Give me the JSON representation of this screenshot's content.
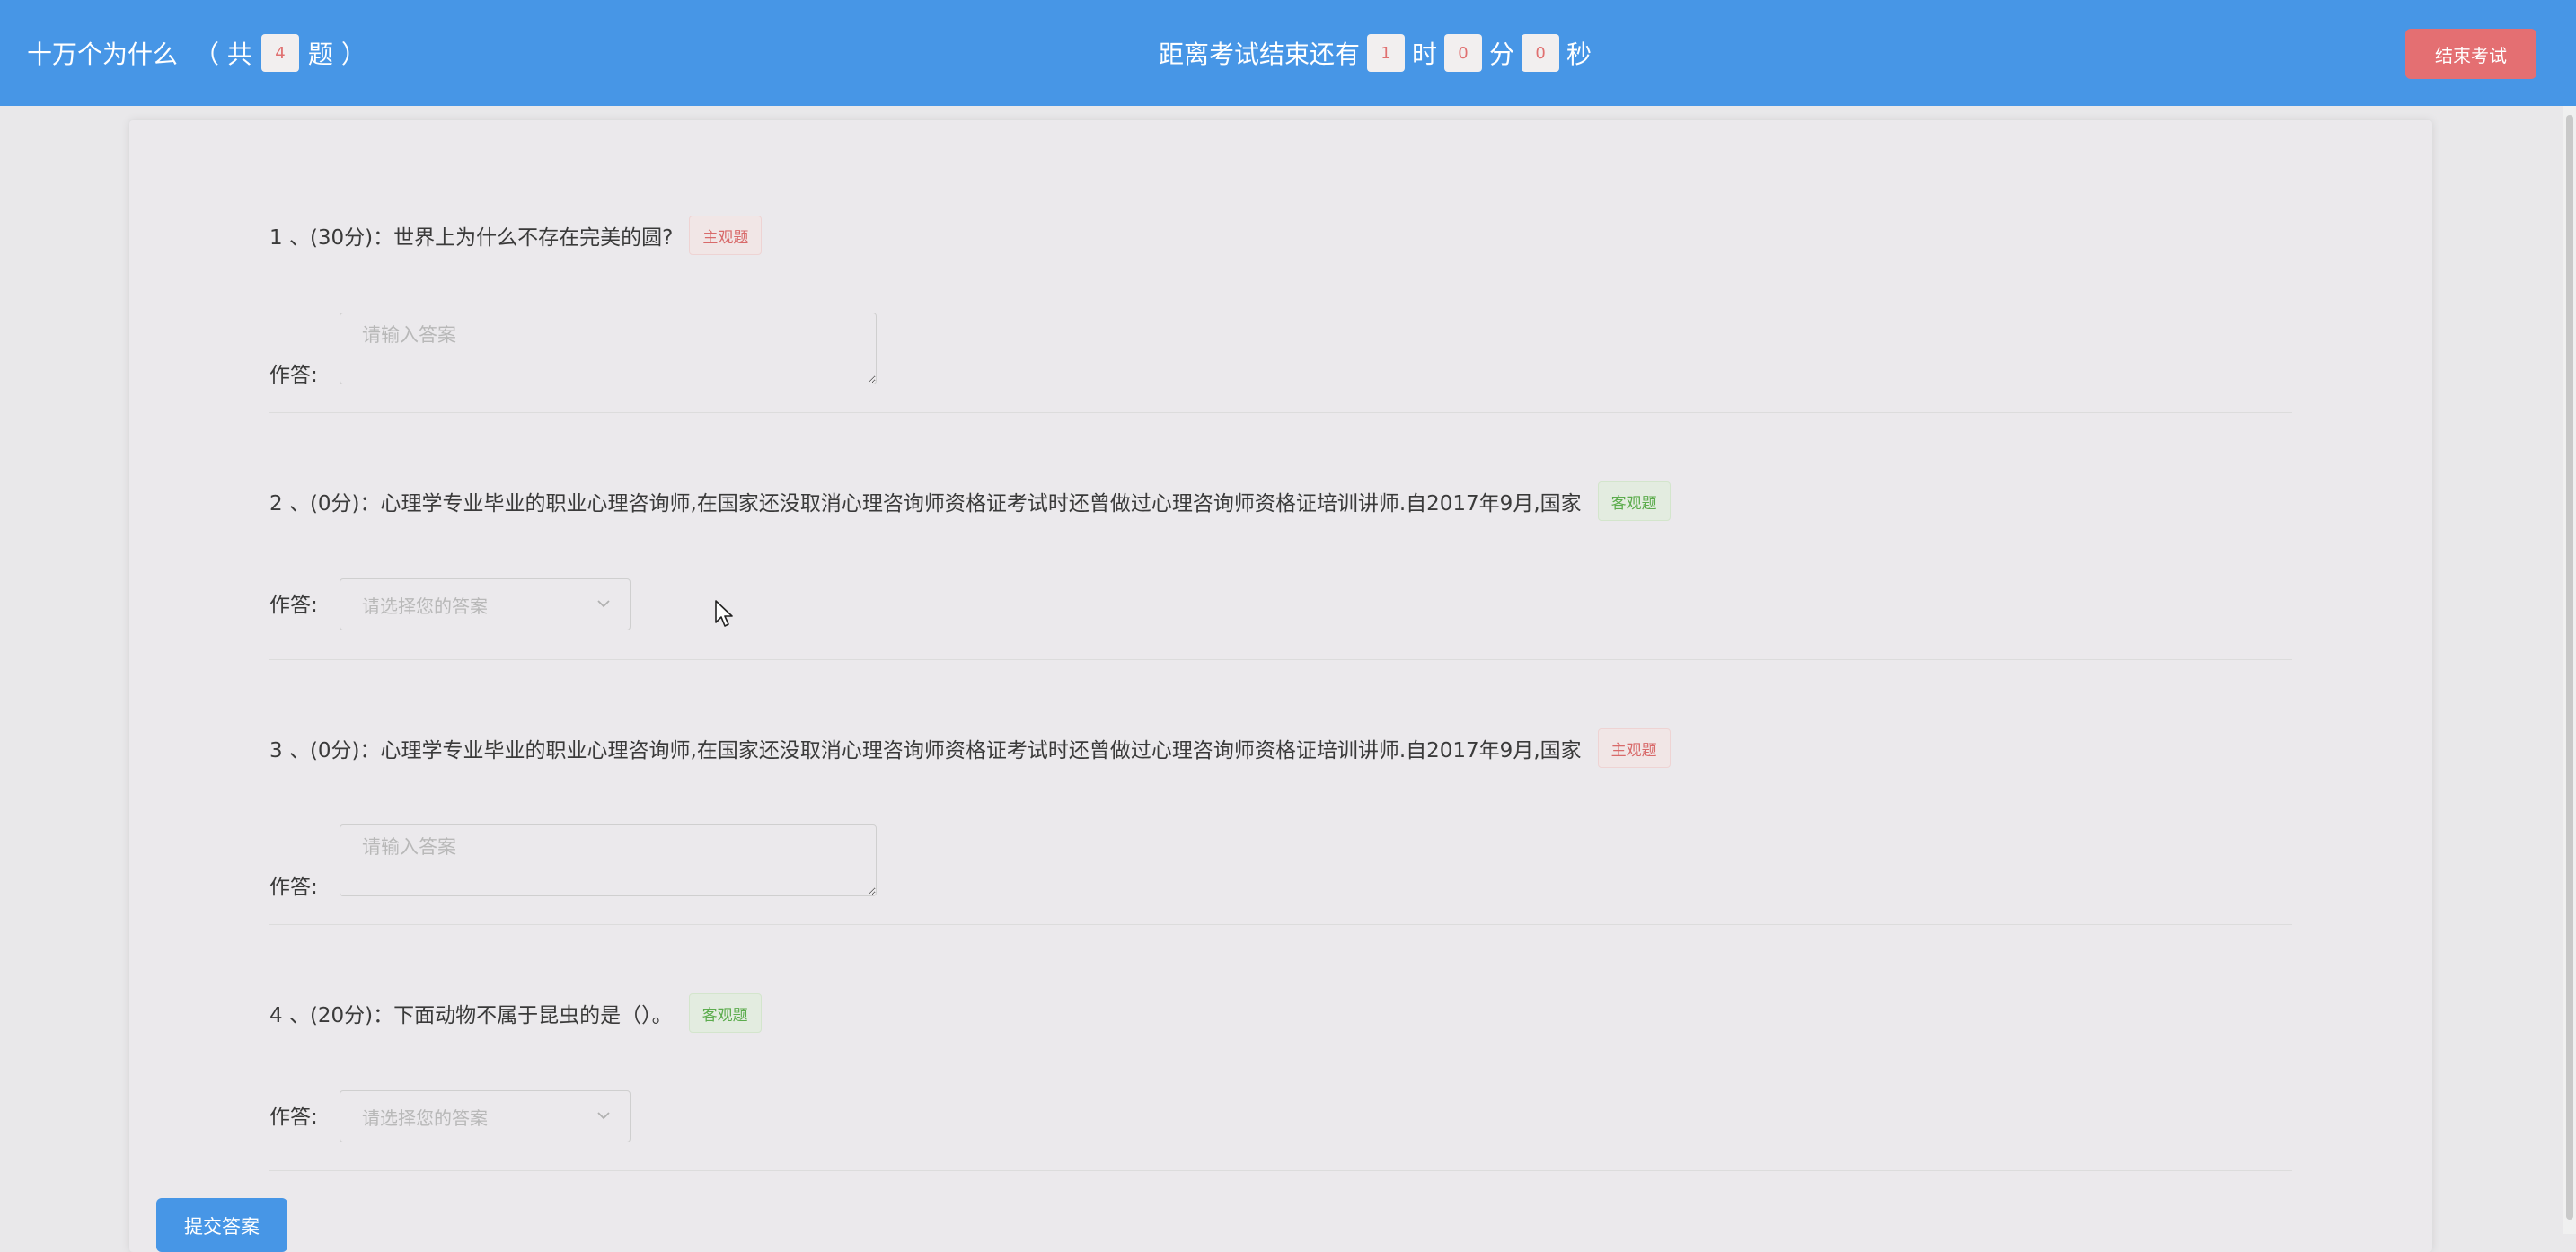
{
  "header": {
    "title": "十万个为什么",
    "count_prefix": "（ 共",
    "count": "4",
    "count_suffix": "题 ）",
    "countdown_prefix": "距离考试结束还有",
    "hours": "1",
    "hour_unit": "时",
    "minutes": "0",
    "minute_unit": "分",
    "seconds": "0",
    "second_unit": "秒",
    "end_button": "结束考试"
  },
  "answer_label": "作答:",
  "questions": [
    {
      "title": "1 、(30分)：世界上为什么不存在完美的圆?",
      "tag": "主观题",
      "type": "textarea",
      "placeholder": "请输入答案"
    },
    {
      "title": "2 、(0分)：心理学专业毕业的职业心理咨询师,在国家还没取消心理咨询师资格证考试时还曾做过心理咨询师资格证培训讲师.自2017年9月,国家",
      "tag": "客观题",
      "type": "select",
      "placeholder": "请选择您的答案"
    },
    {
      "title": "3 、(0分)：心理学专业毕业的职业心理咨询师,在国家还没取消心理咨询师资格证考试时还曾做过心理咨询师资格证培训讲师.自2017年9月,国家",
      "tag": "主观题",
      "type": "textarea",
      "placeholder": "请输入答案"
    },
    {
      "title": "4 、(20分)：下面动物不属于昆虫的是（）。",
      "tag": "客观题",
      "type": "select",
      "placeholder": "请选择您的答案"
    }
  ],
  "submit_button": "提交答案",
  "colors": {
    "header_bg": "#4796e6",
    "end_button_bg": "#e46f72",
    "subjective_tag": "#d86a6a",
    "objective_tag": "#5cac4d"
  }
}
